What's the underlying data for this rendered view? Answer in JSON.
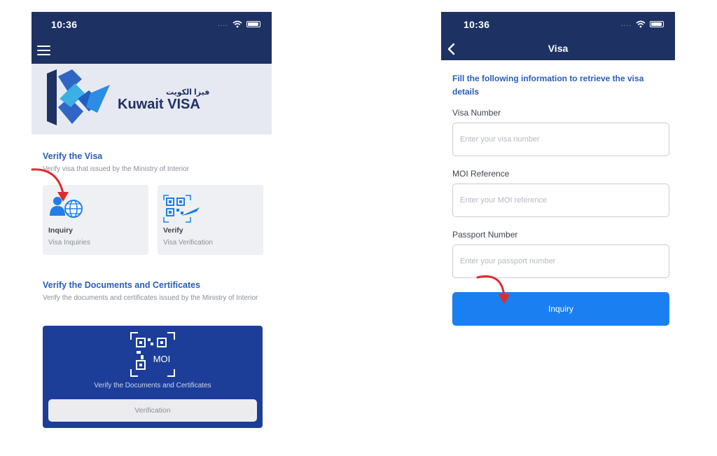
{
  "left_screen": {
    "status_bar": {
      "time": "10:36",
      "signal_dots": "....",
      "icons": [
        "wifi-icon",
        "battery-icon"
      ]
    },
    "navbar": {
      "menu_icon": "hamburger-menu-icon"
    },
    "banner": {
      "arabic_text": "فيزا الكويت",
      "logo_text": "Kuwait VISA"
    },
    "verify_visa": {
      "title": "Verify the Visa",
      "description": "Verify visa that issued by the Ministry of Interior",
      "tiles": [
        {
          "title": "Inquiry",
          "subtitle": "Visa Inquiries",
          "icon": "person-globe-icon"
        },
        {
          "title": "Verify",
          "subtitle": "Visa Verification",
          "icon": "qr-plane-icon"
        }
      ]
    },
    "verify_docs": {
      "title": "Verify the Documents and Certificates",
      "description": "Verify the documents and certificates issued by the Ministry of Interior",
      "card_badge": "MOI",
      "card_label": "Verify the Documents and Certificates",
      "button_label": "Verification"
    }
  },
  "right_screen": {
    "status_bar": {
      "time": "10:36",
      "signal_dots": "...."
    },
    "navbar": {
      "title": "Visa",
      "back_icon": "chevron-left-icon"
    },
    "intro": "Fill the following information to retrieve the visa details",
    "fields": [
      {
        "label": "Visa Number",
        "placeholder": "Enter your visa number"
      },
      {
        "label": "MOI Reference",
        "placeholder": "Enter your MOI reference"
      },
      {
        "label": "Passport Number",
        "placeholder": "Enter your passport number"
      }
    ],
    "button_label": "Inquiry"
  },
  "colors": {
    "navbar": "#1e3163",
    "accent_blue": "#2a5db8",
    "primary_button": "#1a7ff0",
    "doc_card": "#1c3e99",
    "annotation_arrow": "#e02b2b"
  }
}
